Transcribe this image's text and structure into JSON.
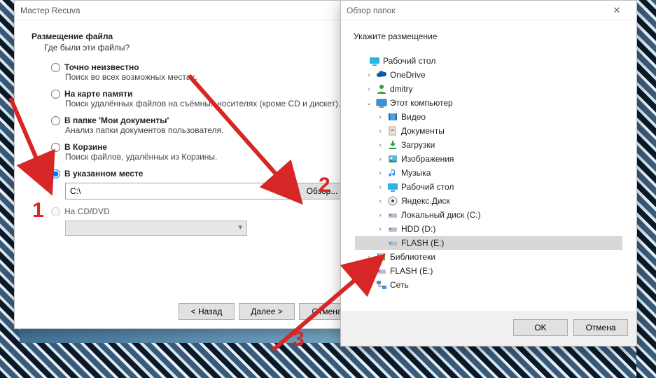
{
  "wizard": {
    "title": "Мастер Recuva",
    "heading": "Размещение файла",
    "subheading": "Где были эти файлы?",
    "options": {
      "unknown": {
        "label": "Точно неизвестно",
        "desc": "Поиск во всех возможных местах."
      },
      "card": {
        "label": "На карте памяти",
        "desc": "Поиск удалённых файлов на съёмных носителях (кроме CD и дискет)."
      },
      "docs": {
        "label": "В папке 'Мои документы'",
        "desc": "Анализ папки документов пользователя."
      },
      "recycle": {
        "label": "В Корзине",
        "desc": "Поиск файлов, удалённых из Корзины."
      },
      "custom": {
        "label": "В указанном месте",
        "path": "C:\\",
        "browse": "Обзор..."
      },
      "cddvd": {
        "label": "На CD/DVD"
      }
    },
    "buttons": {
      "back": "< Назад",
      "next": "Далее >",
      "cancel": "Отмена"
    }
  },
  "browser": {
    "title": "Обзор папок",
    "prompt": "Укажите размещение",
    "buttons": {
      "ok": "OK",
      "cancel": "Отмена"
    },
    "tree": {
      "desktop": "Рабочий стол",
      "onedrive": "OneDrive",
      "user": "dmitry",
      "thispc": "Этот компьютер",
      "videos": "Видео",
      "documents": "Документы",
      "downloads": "Загрузки",
      "pictures": "Изображения",
      "music": "Музыка",
      "desktop2": "Рабочий стол",
      "yandex": "Яндекс.Диск",
      "cdrive": "Локальный диск (C:)",
      "ddrive": "HDD (D:)",
      "edrive": "FLASH (E:)",
      "libraries": "Библиотеки",
      "edrive2": "FLASH (E:)",
      "network": "Сеть"
    }
  },
  "annotations": {
    "n1": "1",
    "n2": "2",
    "n3": "3"
  }
}
